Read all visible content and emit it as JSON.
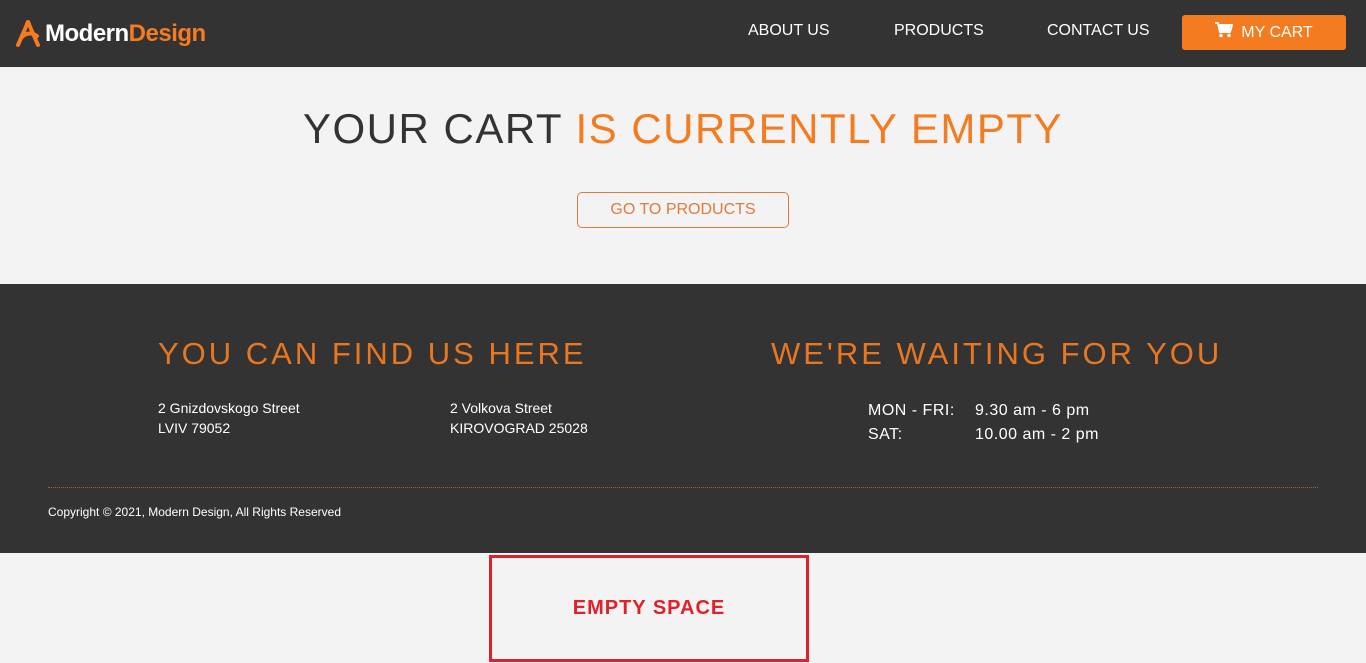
{
  "header": {
    "logo_part1": "Modern",
    "logo_part2": "Design",
    "nav": {
      "about": "ABOUT US",
      "products": "PRODUCTS",
      "contact": "CONTACT US"
    },
    "cart_label": "MY CART"
  },
  "main": {
    "title_part1": "YOUR CART",
    "title_part2": "IS CURRENTLY EMPTY",
    "go_button": "GO TO PRODUCTS"
  },
  "footer": {
    "find_heading": "YOU CAN FIND US HERE",
    "addresses": [
      {
        "line1": "2 Gnizdovskogo Street",
        "line2": "LVIV 79052"
      },
      {
        "line1": "2 Volkova Street",
        "line2": "KIROVOGRAD 25028"
      }
    ],
    "waiting_heading": "WE'RE WAITING FOR YOU",
    "hours": [
      {
        "day": "MON - FRI:",
        "time": "9.30 am - 6 pm"
      },
      {
        "day": "SAT:",
        "time": "10.00 am - 2 pm"
      }
    ],
    "copyright": "Copyright © 2021, Modern Design, All Rights Reserved"
  },
  "annotation": {
    "label": "EMPTY SPACE"
  },
  "colors": {
    "accent": "#f47b20",
    "dark": "#333333",
    "annotation_red": "#e0212b",
    "background": "#f3f3f3"
  },
  "icons": {
    "logo": "logo-icon",
    "cart": "cart-icon"
  }
}
